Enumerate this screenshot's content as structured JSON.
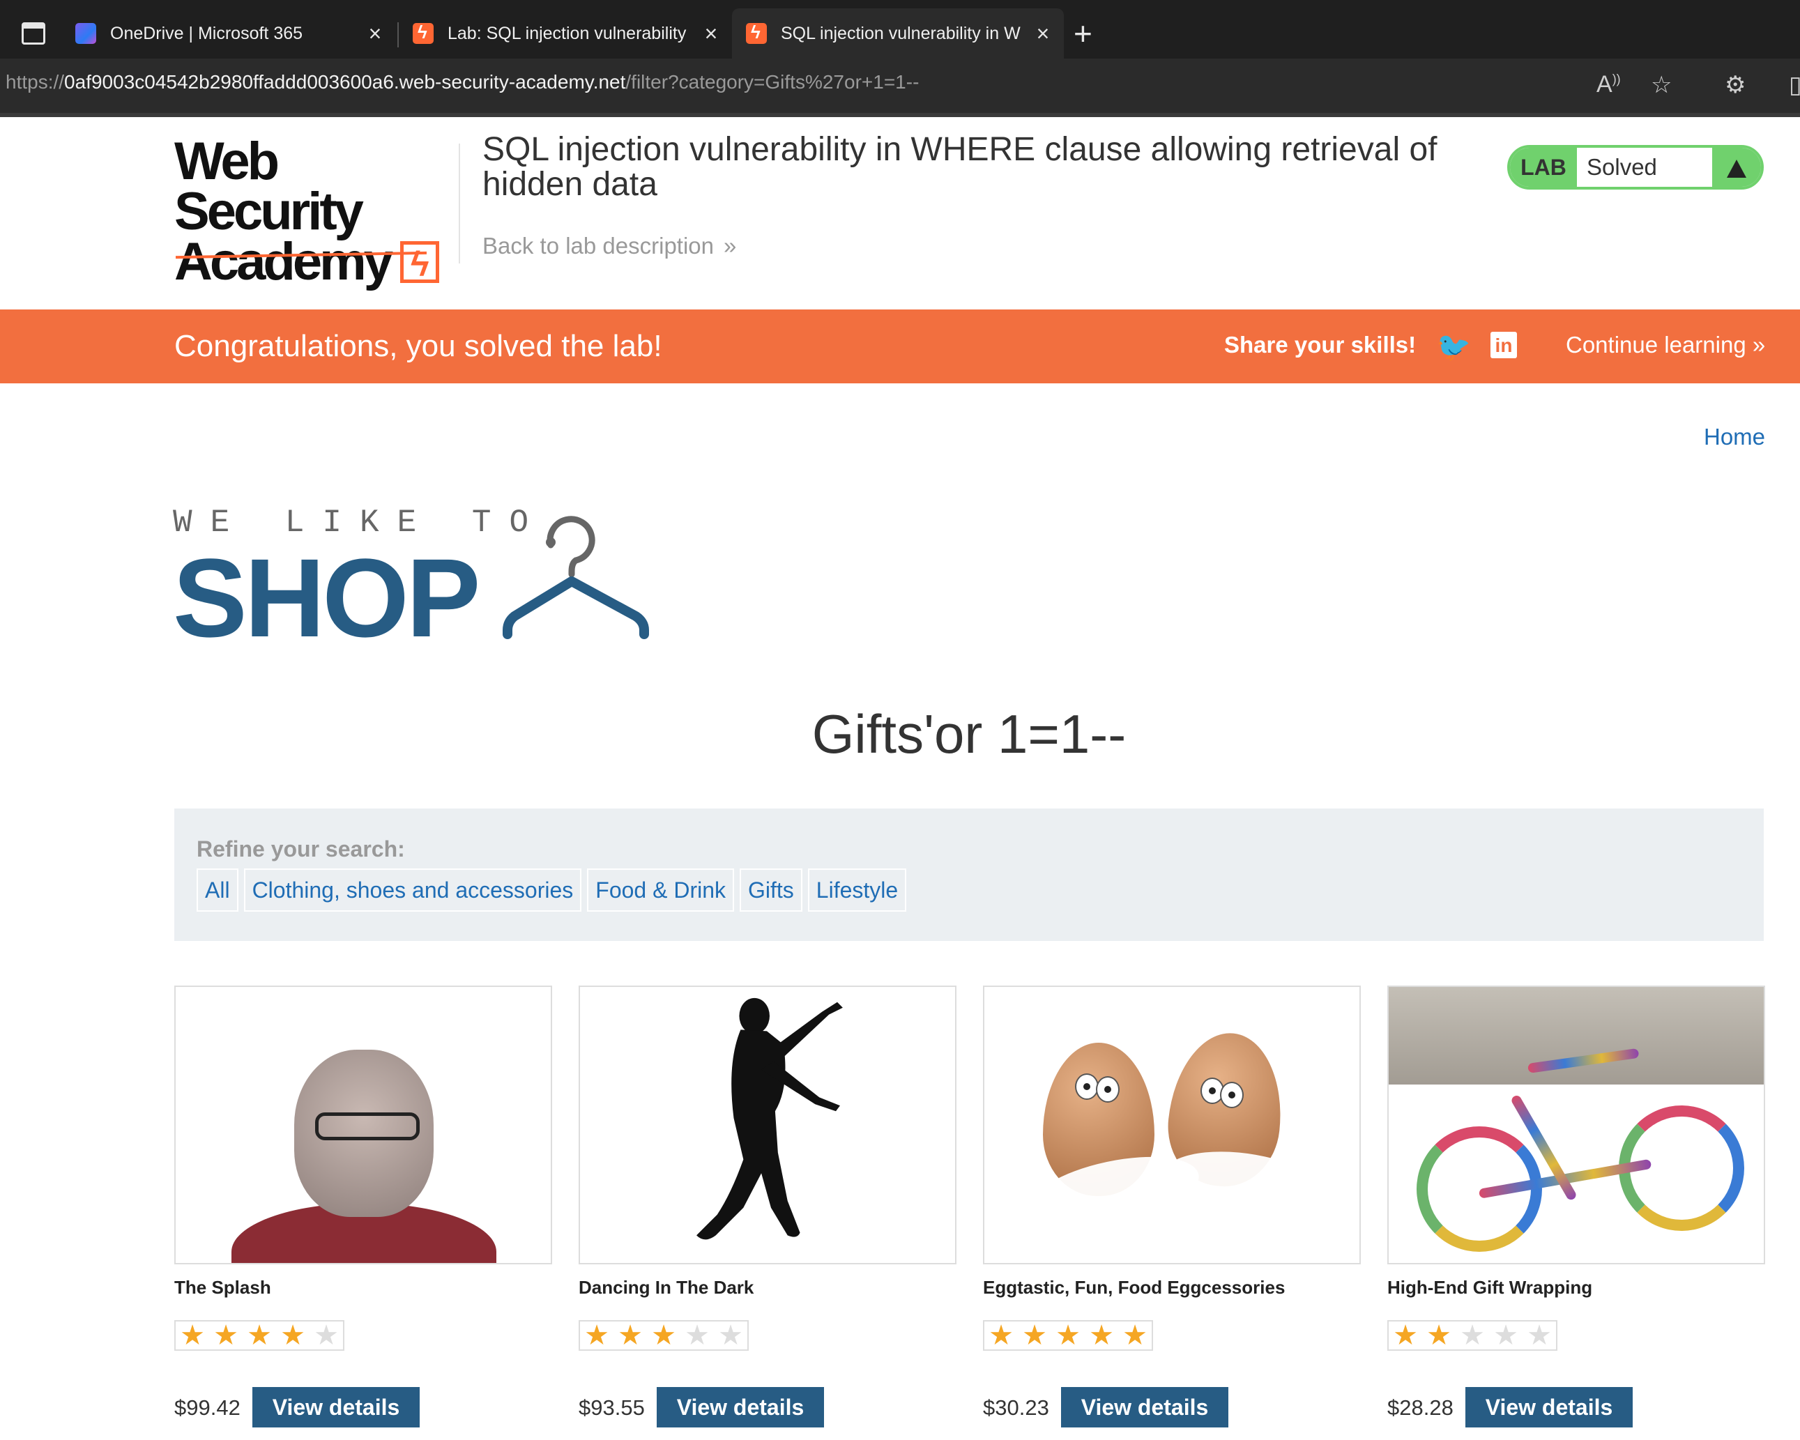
{
  "browser": {
    "tabs": [
      {
        "title": "OneDrive | Microsoft 365",
        "active": false
      },
      {
        "title": "Lab: SQL injection vulnerability",
        "active": false
      },
      {
        "title": "SQL injection vulnerability in W",
        "active": true
      }
    ],
    "url_scheme": "https://",
    "url_host": "0af9003c04542b2980ffaddd003600a6.web-security-academy.net",
    "url_path": "/filter?category=Gifts%27or+1=1--"
  },
  "lab_header": {
    "logo_line1": "Web Security",
    "logo_line2": "Academy",
    "title": "SQL injection vulnerability in WHERE clause allowing retrieval of hidden data",
    "back_link": "Back to lab description",
    "status_label": "LAB",
    "status_value": "Solved"
  },
  "banner": {
    "message": "Congratulations, you solved the lab!",
    "share": "Share your skills!",
    "continue": "Continue learning"
  },
  "shop": {
    "home_link": "Home",
    "logo_tagline": "WE LIKE TO",
    "logo_word": "SHOP",
    "category_title": "Gifts'or 1=1--",
    "refine_label": "Refine your search:",
    "filters": [
      "All",
      "Clothing, shoes and accessories",
      "Food & Drink",
      "Gifts",
      "Lifestyle"
    ],
    "view_button": "View details",
    "products": [
      {
        "name": "The Splash",
        "rating": 4,
        "price": "$99.42"
      },
      {
        "name": "Dancing In The Dark",
        "rating": 3,
        "price": "$93.55"
      },
      {
        "name": "Eggtastic, Fun, Food Eggcessories",
        "rating": 5,
        "price": "$30.23"
      },
      {
        "name": "High-End Gift Wrapping",
        "rating": 2,
        "price": "$28.28"
      }
    ]
  },
  "colors": {
    "brand_orange": "#f26f3f",
    "brand_blue": "#275c84",
    "link_blue": "#1f6db5",
    "solved_green": "#70d16d"
  }
}
